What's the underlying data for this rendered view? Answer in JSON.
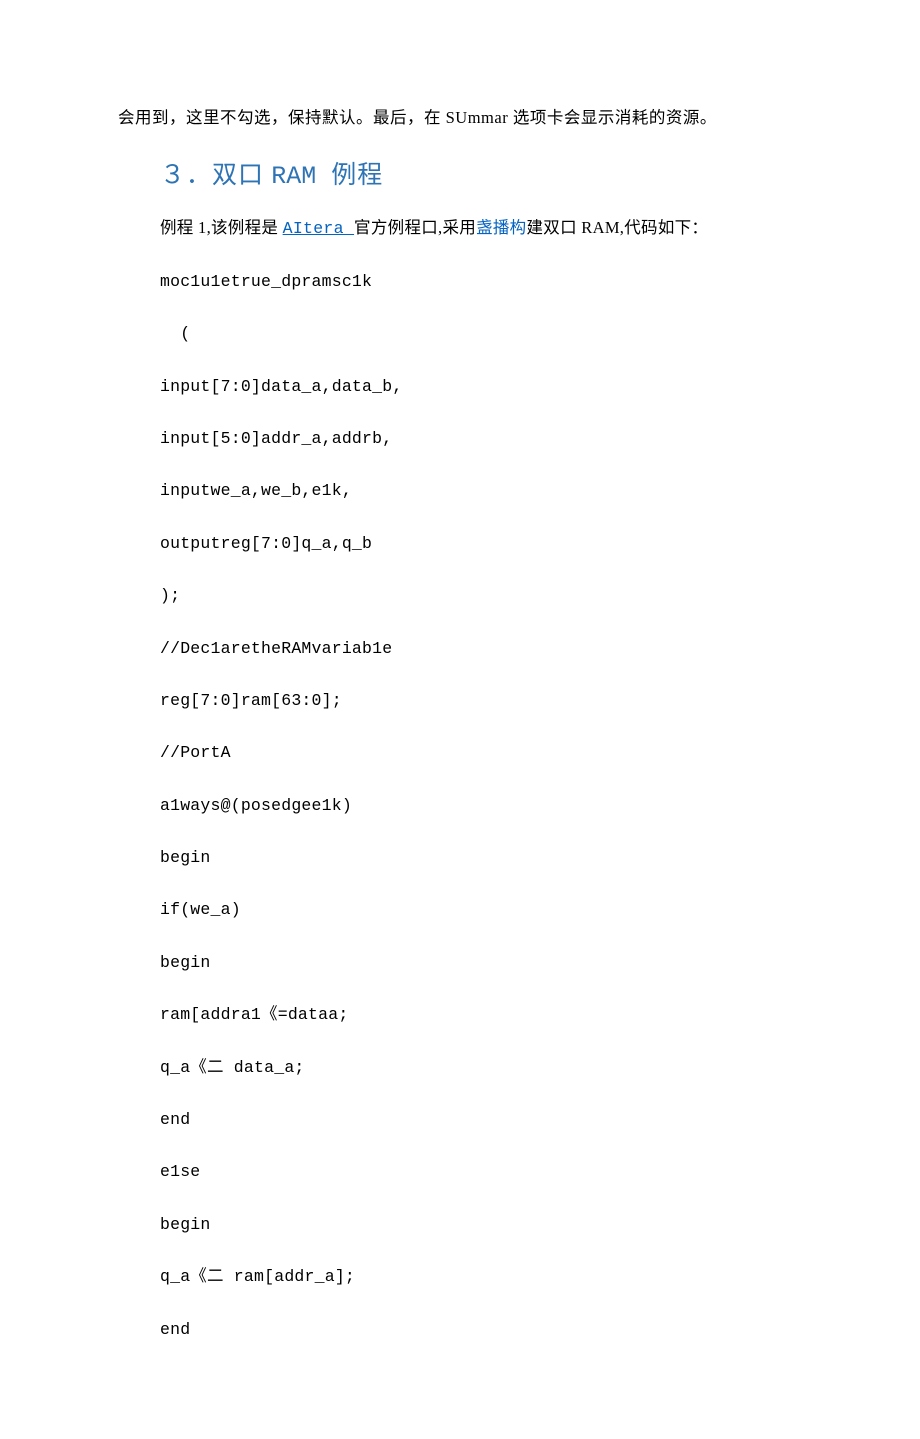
{
  "intro": "会用到，这里不勾选，保持默认。最后，在 SUmmar 选项卡会显示消耗的资源。",
  "heading": {
    "num": "３．双口 ",
    "mono": "RAM ",
    "tail": "例程"
  },
  "para1": {
    "t1": "例程 1,该例程是 ",
    "link1": "AItera ",
    "t2": "官方例程口,采用",
    "link2": "盏播构",
    "t3": "建双口 RAM,代码如下："
  },
  "code": {
    "l01": "moc1u1etrue_dpramsc1k",
    "l02": "  (",
    "l03": "input[7:0]data_a,data_b,",
    "l04": "input[5:0]addr_a,addrb,",
    "l05": "inputwe_a,we_b,e1k,",
    "l06": "outputreg[7:0]q_a,q_b",
    "l07": ");",
    "l08": "//Dec1aretheRAMvariab1e",
    "l09": "reg[7:0]ram[63:0];",
    "l10": "//PortA",
    "l11": "a1ways@(posedgee1k)",
    "l12": "begin",
    "l13": "if(we_a)",
    "l14": "begin",
    "l15": "ram[addra1《=dataa;",
    "l16": "q_a《二 data_a;",
    "l17": "end",
    "l18": "e1se",
    "l19": "begin",
    "l20": "q_a《二 ram[addr_a];",
    "l21": "end"
  }
}
